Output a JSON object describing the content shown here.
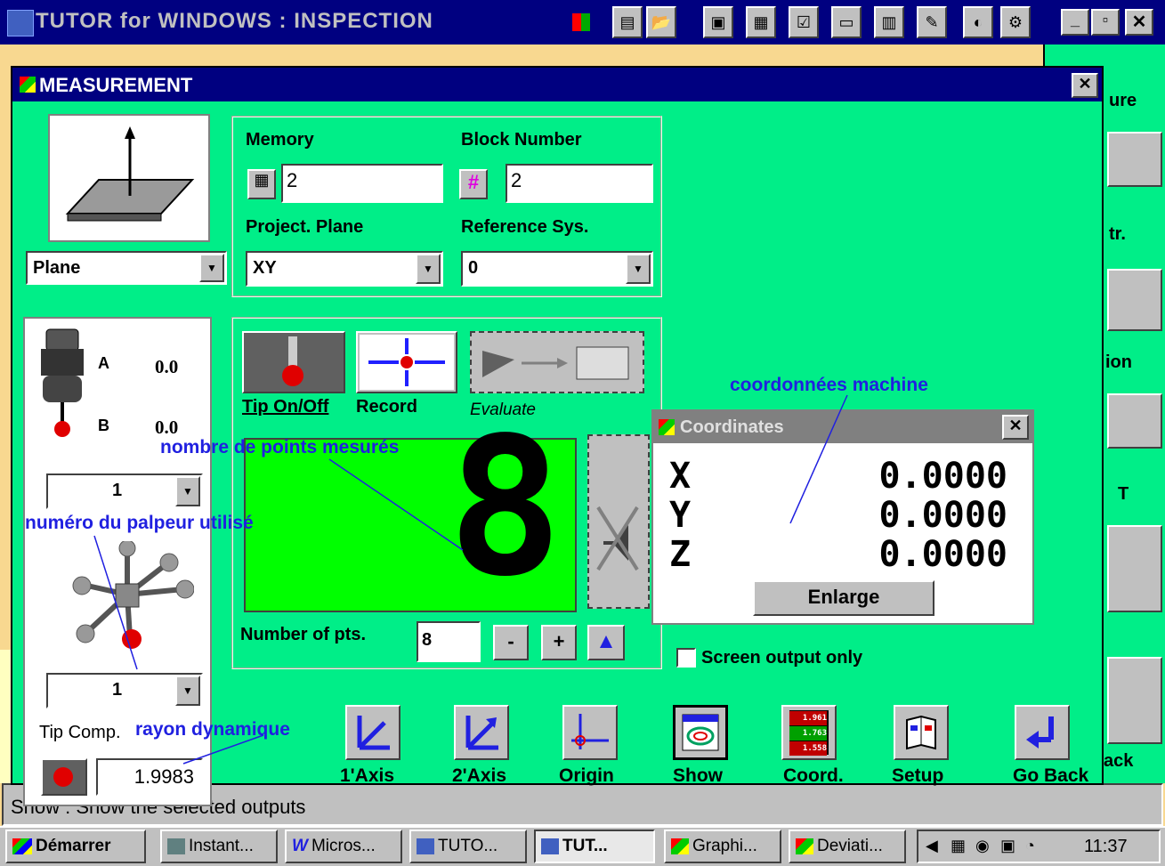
{
  "app": {
    "title": "TUTOR for WINDOWS : INSPECTION",
    "status": "Show : Show the selected outputs",
    "right_panel": [
      "ure",
      "tr.",
      "ion",
      "T",
      "ack"
    ]
  },
  "measurement": {
    "title": "MEASUREMENT",
    "feature": "Plane",
    "memory_label": "Memory",
    "memory_value": "2",
    "block_label": "Block Number",
    "block_value": "2",
    "project_label": "Project. Plane",
    "project_value": "XY",
    "refsys_label": "Reference Sys.",
    "refsys_value": "0",
    "probe_a_label": "A",
    "probe_a_value": "0.0",
    "probe_b_label": "B",
    "probe_b_value": "0.0",
    "probe_select_1": "1",
    "probe_select_2": "1",
    "tip_comp_label": "Tip Comp.",
    "tip_comp_value": "1.9983",
    "tip_onoff": "Tip On/Off",
    "record": "Record",
    "evaluate": "Evaluate",
    "points_display": "8",
    "num_pts_label": "Number of pts.",
    "num_pts_value": "8",
    "minus": "-",
    "plus": "+",
    "screen_output": "Screen output only",
    "buttons": {
      "axis1": "1'Axis",
      "axis2": "2'Axis",
      "origin": "Origin",
      "show": "Show",
      "coord": "Coord.",
      "setup": "Setup",
      "goback": "Go Back"
    },
    "coord_icon_digits": [
      "1.961",
      "1.763",
      "1.558"
    ]
  },
  "coordinates": {
    "title": "Coordinates",
    "rows": [
      {
        "axis": "X",
        "value": "0.0000"
      },
      {
        "axis": "Y",
        "value": "0.0000"
      },
      {
        "axis": "Z",
        "value": "0.0000"
      }
    ],
    "enlarge": "Enlarge"
  },
  "annotations": {
    "machine": "coordonnées machine",
    "points": "nombre de points mesurés",
    "probe": "numéro du palpeur utilisé",
    "radius": "rayon dynamique"
  },
  "taskbar": {
    "start": "Démarrer",
    "tasks": [
      "Instant...",
      "Micros...",
      "TUTO...",
      "TUT...",
      "Graphi...",
      "Deviati..."
    ],
    "clock": "11:37"
  },
  "colors": {
    "window_bg": "#00ee88",
    "title_blue": "#000080",
    "annot": "#2020e0",
    "lcd_bg": "#00ff00"
  }
}
